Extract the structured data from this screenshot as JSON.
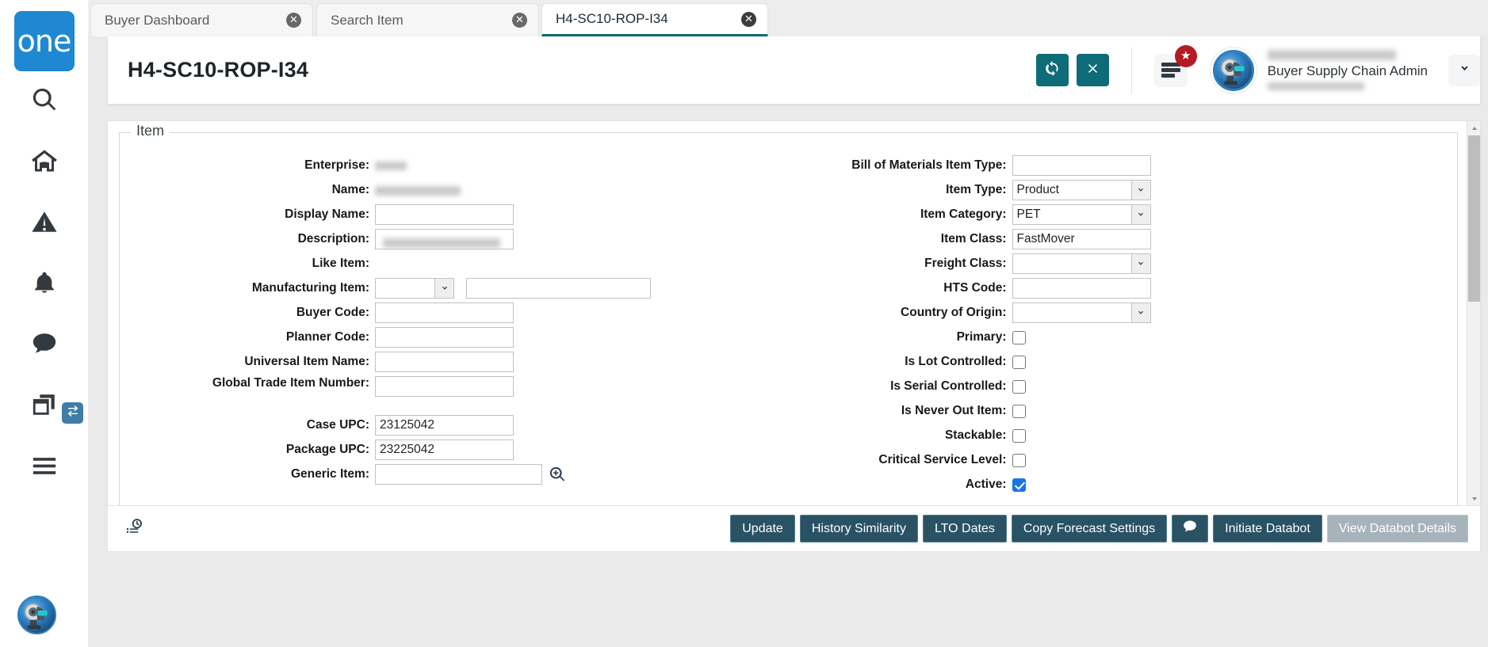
{
  "brand": {
    "logo_text": "one"
  },
  "sidebar": {
    "items": [
      {
        "name": "search-icon",
        "label": "Search"
      },
      {
        "name": "home-icon",
        "label": "Home"
      },
      {
        "name": "alert-icon",
        "label": "Alerts"
      },
      {
        "name": "bell-icon",
        "label": "Notifications"
      },
      {
        "name": "chat-icon",
        "label": "Messages"
      },
      {
        "name": "windows-icon",
        "label": "Workspaces"
      },
      {
        "name": "hamburger-icon",
        "label": "Menu"
      }
    ],
    "switch_badge_icon": "exchange-icon",
    "avatar_icon": "robot-avatar"
  },
  "tabs": [
    {
      "label": "Buyer Dashboard",
      "active": false
    },
    {
      "label": "Search Item",
      "active": false
    },
    {
      "label": "H4-SC10-ROP-I34",
      "active": true
    }
  ],
  "header": {
    "title": "H4-SC10-ROP-I34",
    "refresh_icon": "refresh-icon",
    "close_icon": "close-icon",
    "menu_icon": "list-menu-icon",
    "badge_icon": "star-icon",
    "caret_icon": "chevron-down-icon",
    "user": {
      "name_redacted": true,
      "role": "Buyer Supply Chain Admin",
      "email_redacted": true
    }
  },
  "form": {
    "legend": "Item",
    "left_fields": [
      {
        "label": "Enterprise:",
        "type": "redacted-text",
        "value": ""
      },
      {
        "label": "Name:",
        "type": "redacted-text",
        "value": ""
      },
      {
        "label": "Display Name:",
        "type": "text",
        "value": ""
      },
      {
        "label": "Description:",
        "type": "text-redacted",
        "value": ""
      },
      {
        "label": "Like Item:",
        "type": "empty",
        "value": ""
      },
      {
        "label": "Manufacturing Item:",
        "type": "select-plus-text",
        "value": ""
      },
      {
        "label": "Buyer Code:",
        "type": "text",
        "value": ""
      },
      {
        "label": "Planner Code:",
        "type": "text",
        "value": ""
      },
      {
        "label": "Universal Item Name:",
        "type": "text",
        "value": ""
      },
      {
        "label": "Global Trade Item Number:",
        "type": "text",
        "value": ""
      },
      {
        "label": "Case UPC:",
        "type": "text",
        "value": "23125042"
      },
      {
        "label": "Package UPC:",
        "type": "text",
        "value": "23225042"
      },
      {
        "label": "Generic Item:",
        "type": "text-lookup",
        "value": ""
      }
    ],
    "right_fields": [
      {
        "label": "Bill of Materials Item Type:",
        "type": "text",
        "value": ""
      },
      {
        "label": "Item Type:",
        "type": "select",
        "value": "Product"
      },
      {
        "label": "Item Category:",
        "type": "select",
        "value": "PET"
      },
      {
        "label": "Item Class:",
        "type": "text",
        "value": "FastMover"
      },
      {
        "label": "Freight Class:",
        "type": "select",
        "value": ""
      },
      {
        "label": "HTS Code:",
        "type": "text",
        "value": ""
      },
      {
        "label": "Country of Origin:",
        "type": "select",
        "value": ""
      },
      {
        "label": "Primary:",
        "type": "checkbox",
        "checked": false
      },
      {
        "label": "Is Lot Controlled:",
        "type": "checkbox",
        "checked": false
      },
      {
        "label": "Is Serial Controlled:",
        "type": "checkbox",
        "checked": false
      },
      {
        "label": "Is Never Out Item:",
        "type": "checkbox",
        "checked": false
      },
      {
        "label": "Stackable:",
        "type": "checkbox",
        "checked": false
      },
      {
        "label": "Critical Service Level:",
        "type": "checkbox",
        "checked": false
      },
      {
        "label": "Active:",
        "type": "checkbox",
        "checked": true
      }
    ],
    "lookup_icon": "magnifier-plus-icon"
  },
  "bottom_bar": {
    "history_icon": "audit-history-icon",
    "buttons": [
      {
        "label": "Update",
        "disabled": false,
        "icon": null
      },
      {
        "label": "History Similarity",
        "disabled": false,
        "icon": null
      },
      {
        "label": "LTO Dates",
        "disabled": false,
        "icon": null
      },
      {
        "label": "Copy Forecast Settings",
        "disabled": false,
        "icon": null
      },
      {
        "label": "",
        "disabled": false,
        "icon": "comment-icon"
      },
      {
        "label": "Initiate Databot",
        "disabled": false,
        "icon": null
      },
      {
        "label": "View Databot Details",
        "disabled": true,
        "icon": null
      }
    ]
  },
  "colors": {
    "brand_blue": "#1e88d2",
    "accent_teal": "#0e6b78",
    "button_navy": "#2a5265",
    "badge_red": "#b41b22",
    "checkbox_blue": "#1a73e8"
  }
}
